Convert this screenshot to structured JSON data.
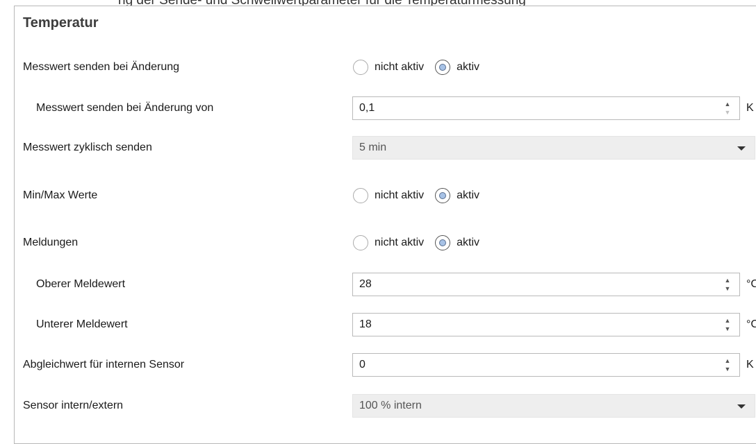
{
  "top_text": "ng der Sende- und Schwellwertparameter für die Temperaturmessung",
  "panel": {
    "title": "Temperatur",
    "rows": [
      {
        "label": "Messwert senden bei Änderung",
        "options": [
          "nicht aktiv",
          "aktiv"
        ],
        "selected": "aktiv"
      },
      {
        "label": "Messwert senden bei Änderung von",
        "value": "0,1",
        "unit": "K"
      },
      {
        "label": "Messwert zyklisch senden",
        "value": "5 min"
      },
      {
        "label": "Min/Max Werte",
        "options": [
          "nicht aktiv",
          "aktiv"
        ],
        "selected": "aktiv"
      },
      {
        "label": "Meldungen",
        "options": [
          "nicht aktiv",
          "aktiv"
        ],
        "selected": "aktiv"
      },
      {
        "label": "Oberer Meldewert",
        "value": "28",
        "unit": "°C"
      },
      {
        "label": "Unterer Meldewert",
        "value": "18",
        "unit": "°C"
      },
      {
        "label": "Abgleichwert für internen Sensor",
        "value": "0",
        "unit": "K"
      },
      {
        "label": "Sensor intern/extern",
        "value": "100 % intern"
      }
    ]
  },
  "icons": {
    "spin_up": "▲",
    "spin_down": "▼"
  },
  "colors": {
    "radio_selected_fill": "#a7c2e6",
    "select_background": "#eeeeee",
    "border": "#b9b9b9"
  }
}
